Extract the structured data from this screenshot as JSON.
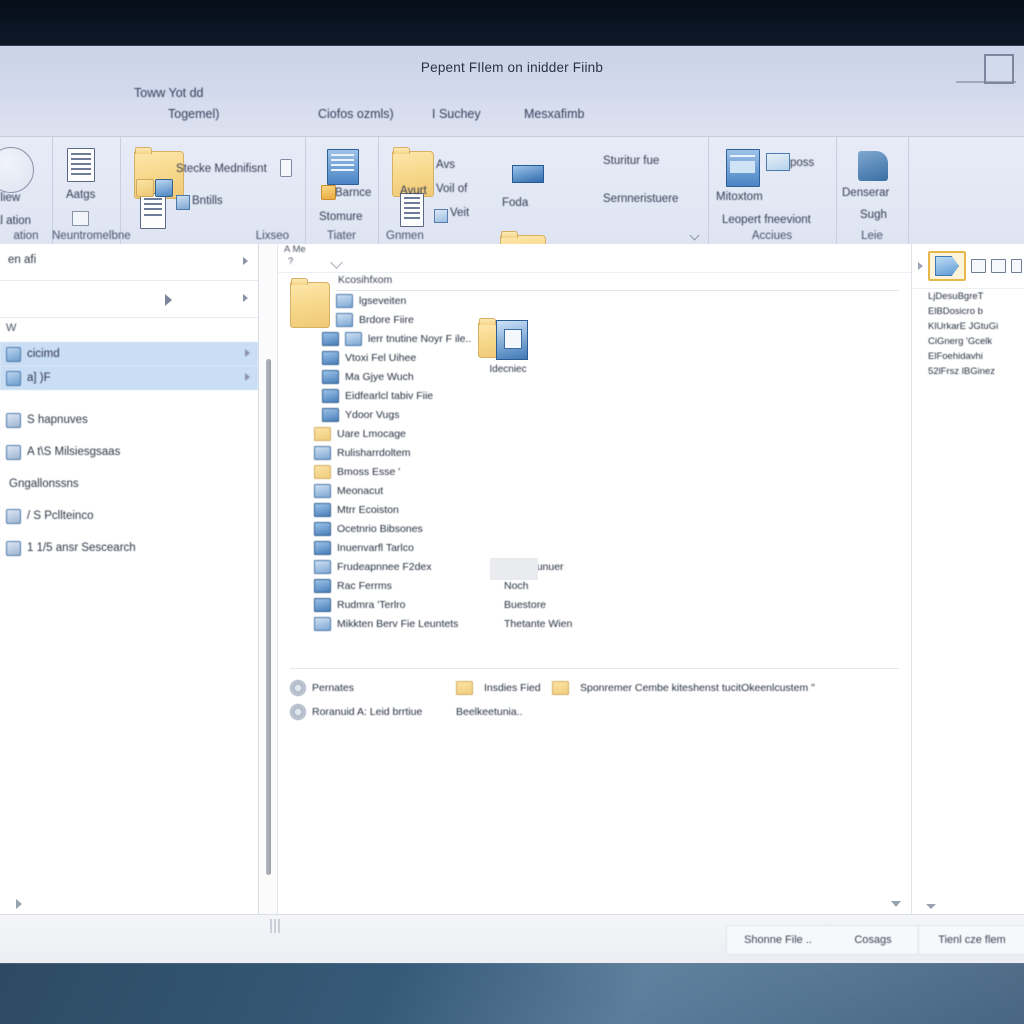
{
  "window": {
    "title": "Pepent FIlem on inidder Fiinb",
    "controls": {
      "maximize_label": "maximize-box"
    }
  },
  "quick_access": {
    "tabs": [
      {
        "label": "Toww Yot dd"
      },
      {
        "label": "Togemel)"
      },
      {
        "label": "Ciofos ozmls)"
      },
      {
        "label": "I Suchey"
      },
      {
        "label": "Mesxafimb"
      }
    ]
  },
  "ribbon": {
    "groups": [
      {
        "label": "ation",
        "buttons": [
          {
            "label": "t liew"
          },
          {
            "label": "al ation"
          }
        ]
      },
      {
        "label": "Neuntromelbne",
        "buttons": [
          {
            "label": "Aatgs"
          }
        ]
      },
      {
        "label": "Lixseo",
        "buttons": [
          {
            "label": "Stecke Mednifisnt"
          },
          {
            "label": "Bntills"
          }
        ]
      },
      {
        "label": "Tiater",
        "buttons": [
          {
            "label": "Barnce"
          },
          {
            "label": "Stomure"
          }
        ]
      },
      {
        "label": "Gnmen",
        "buttons": [
          {
            "label": "Avs"
          },
          {
            "label": "Voil of"
          },
          {
            "label": "Veit"
          },
          {
            "label": "Avurt"
          },
          {
            "label": "Foda"
          },
          {
            "label": "Sturitur fue"
          },
          {
            "label": "Sernneristuere"
          }
        ]
      },
      {
        "label": "Acciues",
        "buttons": [
          {
            "label": "poss"
          },
          {
            "label": "Mitoxtom"
          },
          {
            "label": "Leopert fneeviont"
          }
        ]
      },
      {
        "label": "Leie",
        "buttons": [
          {
            "label": "Denserar"
          },
          {
            "label": "Sugh"
          }
        ]
      }
    ]
  },
  "nav_pane": {
    "header_label": "en afi",
    "sub_label": "W",
    "items": [
      {
        "label": "cicimd",
        "selected": true,
        "icon": "folder-blue-icon"
      },
      {
        "label": "a] )F",
        "selected": true,
        "icon": "folder-blue-icon"
      },
      {
        "label": "S hapnuves",
        "selected": false,
        "icon": "star-icon"
      },
      {
        "label": "A t\\S Milsiesgsaas",
        "selected": false,
        "icon": "star-icon"
      },
      {
        "label": "Gngallonssns",
        "selected": false,
        "icon": "star-icon"
      },
      {
        "label": "/ S Pcllteinco",
        "selected": false,
        "icon": "star-icon"
      },
      {
        "label": "1 1/5 ansr Sescearch",
        "selected": false,
        "icon": "star-icon"
      }
    ]
  },
  "content": {
    "breadcrumb": "A Me",
    "breadcrumb_sub": "?",
    "column_header": "Kcosihfxom",
    "files": [
      {
        "name": "lgseveiten",
        "icon": "mixed-icon",
        "col2": ""
      },
      {
        "name": "Brdore Fiire",
        "icon": "mixed-icon",
        "col2": ""
      },
      {
        "name": "lerr tnutine Noyr F ile..",
        "icon": "mixed-icon",
        "col2": ""
      },
      {
        "name": "Vtoxi Fel Uihee",
        "icon": "blue-icon",
        "col2": ""
      },
      {
        "name": "Ma Gjye Wuch",
        "icon": "blue-icon",
        "col2": ""
      },
      {
        "name": "Eidfearlcl tabiv Fiie",
        "icon": "blue-icon",
        "col2": ""
      },
      {
        "name": "Ydoor Vugs",
        "icon": "blue-icon",
        "col2": ""
      },
      {
        "name": "Uare Lmocage",
        "icon": "folder-icon",
        "col2": ""
      },
      {
        "name": "Rulisharrdoltem",
        "icon": "mixed-icon",
        "col2": ""
      },
      {
        "name": "Bmoss Esse '",
        "icon": "folder-icon",
        "col2": ""
      },
      {
        "name": "Meonacut",
        "icon": "mixed-icon",
        "col2": ""
      },
      {
        "name": "Mtrr Ecoiston",
        "icon": "blue-icon",
        "col2": ""
      },
      {
        "name": "Ocetnrio Bibsones",
        "icon": "blue-icon",
        "col2": ""
      },
      {
        "name": "Inuenvarfl Tarlco",
        "icon": "blue-icon",
        "col2": ""
      },
      {
        "name": "Frudeapnnee F2dex",
        "icon": "mixed-icon",
        "col2": "Eonteitunuer"
      },
      {
        "name": "Rac Ferrms",
        "icon": "blue-icon",
        "col2": "Noch"
      },
      {
        "name": "Rudmra 'Terlro",
        "icon": "blue-icon",
        "col2": "Buestore"
      },
      {
        "name": "Mikkten Berv Fie Leuntets",
        "icon": "mixed-icon",
        "col2": "Thetante Wien"
      }
    ],
    "footer_rows": [
      {
        "name": "Pernates",
        "icon": "gear-icon",
        "col2": "Insdies Fied",
        "col3": "Sponremer Cembe kiteshenst tucitOkeenlcustem \""
      },
      {
        "name": "Roranuid A: Leid brrtiue",
        "icon": "gear-icon",
        "col2": "Beelkeetunia..",
        "col3": ""
      }
    ],
    "preview_tile_label": "Idecniec",
    "ghost_box": "placeholder-thumbnail"
  },
  "right_pane": {
    "toolbar": {
      "selected_tool": "arrow-tool-icon",
      "tools": [
        "copy-icon",
        "paste-icon",
        "more-icon"
      ]
    },
    "rows": [
      {
        "label": "LjDesuBgreT"
      },
      {
        "label": "ElBDosicro b"
      },
      {
        "label": "KlUrkarE JGtuGi"
      },
      {
        "label": "CiGnerg 'Gcelk"
      },
      {
        "label": "ElFoehidavhi"
      },
      {
        "label": "52lFrsz lBGinez"
      }
    ]
  },
  "status_bar": {
    "cells": [
      {
        "label": "Shonne File .."
      },
      {
        "label": "Cosags"
      },
      {
        "label": "Tienl cze flem"
      }
    ]
  },
  "colors": {
    "desktop_top": "#0a1423",
    "desktop_bottom": "#3a5a78",
    "titlebar": "#ccd4ea",
    "ribbon": "#e7ebf6",
    "selection_blue": "#c9ddf5",
    "accent_folder": "#f0cd7d",
    "accent_blue": "#4a7fba",
    "highlight_gold": "#e6b84a"
  }
}
